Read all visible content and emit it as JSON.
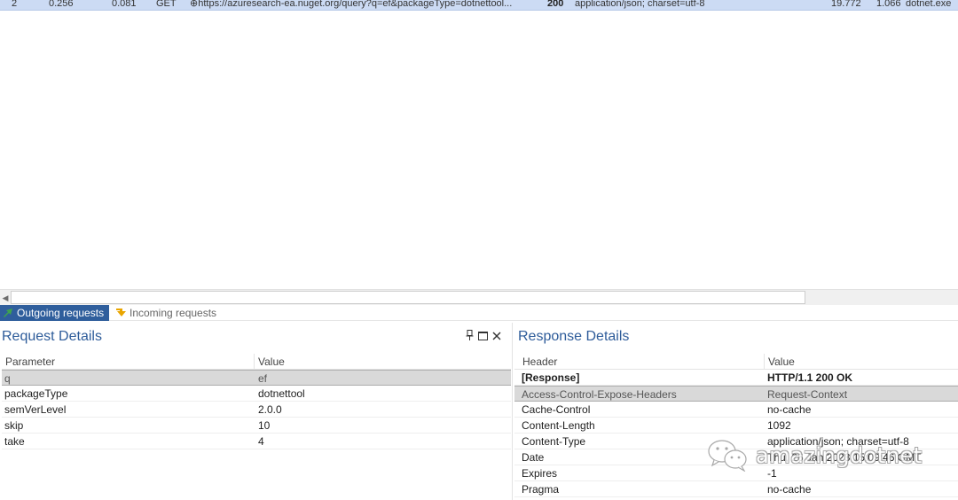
{
  "request_row": {
    "num": "2",
    "time1": "0.256",
    "time2": "0.081",
    "method": "GET",
    "url": "⊕https://azuresearch-ea.nuget.org/query?q=ef&packageType=dotnettool...",
    "status": "200",
    "content_type": "application/json; charset=utf-8",
    "size": "19.772",
    "duration": "1.066",
    "process": "dotnet.exe"
  },
  "tabs": {
    "outgoing": "Outgoing requests",
    "incoming": "Incoming requests"
  },
  "request_details": {
    "title": "Request Details",
    "pin_icon": "📌",
    "columns": [
      "Parameter",
      "Value"
    ],
    "rows": [
      {
        "name": "q",
        "value": "ef"
      },
      {
        "name": "packageType",
        "value": "dotnettool"
      },
      {
        "name": "semVerLevel",
        "value": "2.0.0"
      },
      {
        "name": "skip",
        "value": "10"
      },
      {
        "name": "take",
        "value": "4"
      }
    ]
  },
  "response_details": {
    "title": "Response Details",
    "columns": [
      "Header",
      "Value"
    ],
    "rows": [
      {
        "name": "[Response]",
        "value": "HTTP/1.1 200 OK"
      },
      {
        "name": "Access-Control-Expose-Headers",
        "value": "Request-Context"
      },
      {
        "name": "Cache-Control",
        "value": "no-cache"
      },
      {
        "name": "Content-Length",
        "value": "1092"
      },
      {
        "name": "Content-Type",
        "value": "application/json; charset=utf-8"
      },
      {
        "name": "Date",
        "value": "Thu, 26 Jan 2023 15:09:46 GMT"
      },
      {
        "name": "Expires",
        "value": "-1"
      },
      {
        "name": "Pragma",
        "value": "no-cache"
      }
    ]
  },
  "watermark": {
    "text": "amazingdotnet"
  },
  "colors": {
    "selected_row": "#ccdbf4",
    "active_tab": "#2f5e9c",
    "panel_title": "#2e5c9a"
  }
}
